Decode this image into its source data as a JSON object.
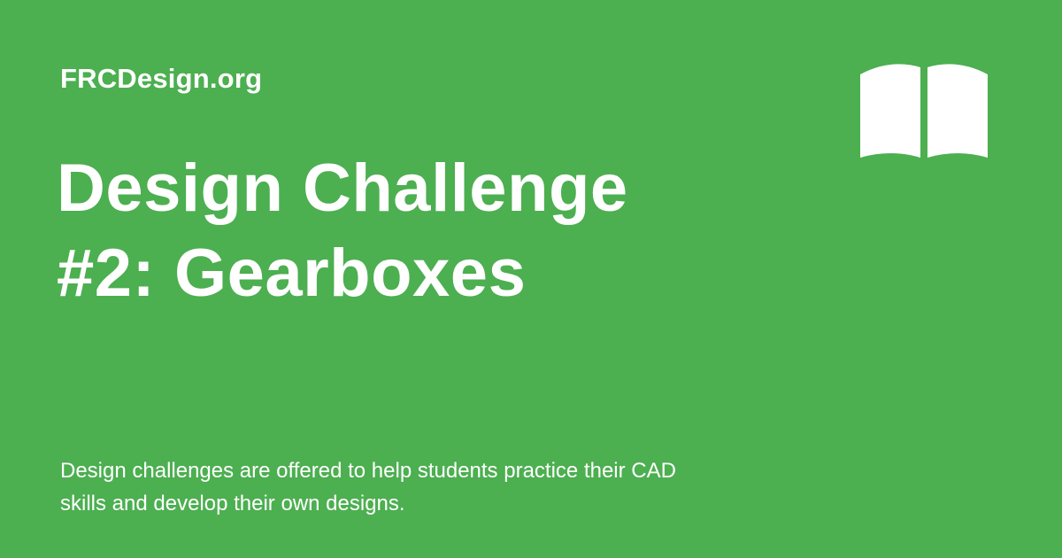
{
  "site": {
    "name": "FRCDesign.org"
  },
  "title": {
    "lines": [
      "Design Challenge",
      "#2: Gearboxes"
    ]
  },
  "description": {
    "lines": [
      "Design challenges are offered to help students practice their CAD",
      "skills and develop their own designs."
    ]
  },
  "icon": {
    "name": "open-book-icon"
  },
  "colors": {
    "background": "#4caf50",
    "text": "#ffffff"
  }
}
